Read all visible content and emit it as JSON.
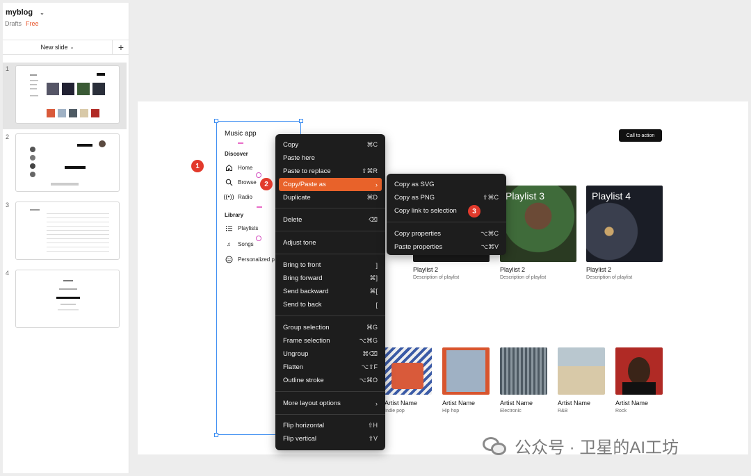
{
  "project": {
    "name": "myblog",
    "status": "Drafts",
    "plan": "Free"
  },
  "sidebar": {
    "new_slide_label": "New slide",
    "slides": [
      {
        "num": "1"
      },
      {
        "num": "2"
      },
      {
        "num": "3"
      },
      {
        "num": "4"
      }
    ]
  },
  "app": {
    "title": "Music app",
    "discover_label": "Discover",
    "nav": {
      "home": "Home",
      "browse": "Browse",
      "radio": "Radio"
    },
    "library_label": "Library",
    "library": {
      "playlists": "Playlists",
      "songs": "Songs",
      "personalized": "Personalized p"
    },
    "cta": "Call to action"
  },
  "playlists": [
    {
      "cover_title": "",
      "name": "Playlist 2",
      "desc": "Description of playlist",
      "color": "#1a1a1a"
    },
    {
      "cover_title": "Playlist 3",
      "name": "Playlist 2",
      "desc": "Description of playlist",
      "color": "#3f6b3a"
    },
    {
      "cover_title": "Playlist 4",
      "name": "Playlist 2",
      "desc": "Description of playlist",
      "color": "#2a2f3a"
    }
  ],
  "artists": [
    {
      "name": "Artist Name",
      "genre": "Indie pop",
      "color": "#d95a3a"
    },
    {
      "name": "Artist Name",
      "genre": "Hip hop",
      "color": "#9fb1c4"
    },
    {
      "name": "Artist Name",
      "genre": "Electronic",
      "color": "#4e5a63"
    },
    {
      "name": "Artist Name",
      "genre": "R&B",
      "color": "#d8c9a8"
    },
    {
      "name": "Artist Name",
      "genre": "Rock",
      "color": "#b02a25"
    }
  ],
  "menu": {
    "copy": "Copy",
    "copy_sc": "⌘C",
    "paste_here": "Paste here",
    "paste_replace": "Paste to replace",
    "paste_replace_sc": "⇧⌘R",
    "copy_paste_as": "Copy/Paste as",
    "copy_paste_as_sc": "›",
    "duplicate": "Duplicate",
    "duplicate_sc": "⌘D",
    "delete": "Delete",
    "delete_sc": "⌫",
    "adjust_tone": "Adjust tone",
    "bring_front": "Bring to front",
    "bring_front_sc": "]",
    "bring_forward": "Bring forward",
    "bring_forward_sc": "⌘]",
    "send_backward": "Send backward",
    "send_backward_sc": "⌘[",
    "send_back": "Send to back",
    "send_back_sc": "[",
    "group": "Group selection",
    "group_sc": "⌘G",
    "frame": "Frame selection",
    "frame_sc": "⌥⌘G",
    "ungroup": "Ungroup",
    "ungroup_sc": "⌘⌫",
    "flatten": "Flatten",
    "flatten_sc": "⌥⇧F",
    "outline": "Outline stroke",
    "outline_sc": "⌥⌘O",
    "more_layout": "More layout options",
    "more_layout_sc": "›",
    "flip_h": "Flip horizontal",
    "flip_h_sc": "⇧H",
    "flip_v": "Flip vertical",
    "flip_v_sc": "⇧V"
  },
  "submenu": {
    "svg": "Copy as SVG",
    "png": "Copy as PNG",
    "png_sc": "⇧⌘C",
    "link": "Copy link to selection",
    "copy_props": "Copy properties",
    "copy_props_sc": "⌥⌘C",
    "paste_props": "Paste properties",
    "paste_props_sc": "⌥⌘V"
  },
  "badges": {
    "b1": "1",
    "b2": "2",
    "b3": "3"
  },
  "watermark": "公众号 · 卫星的AI工坊",
  "accent": "#e8622a"
}
